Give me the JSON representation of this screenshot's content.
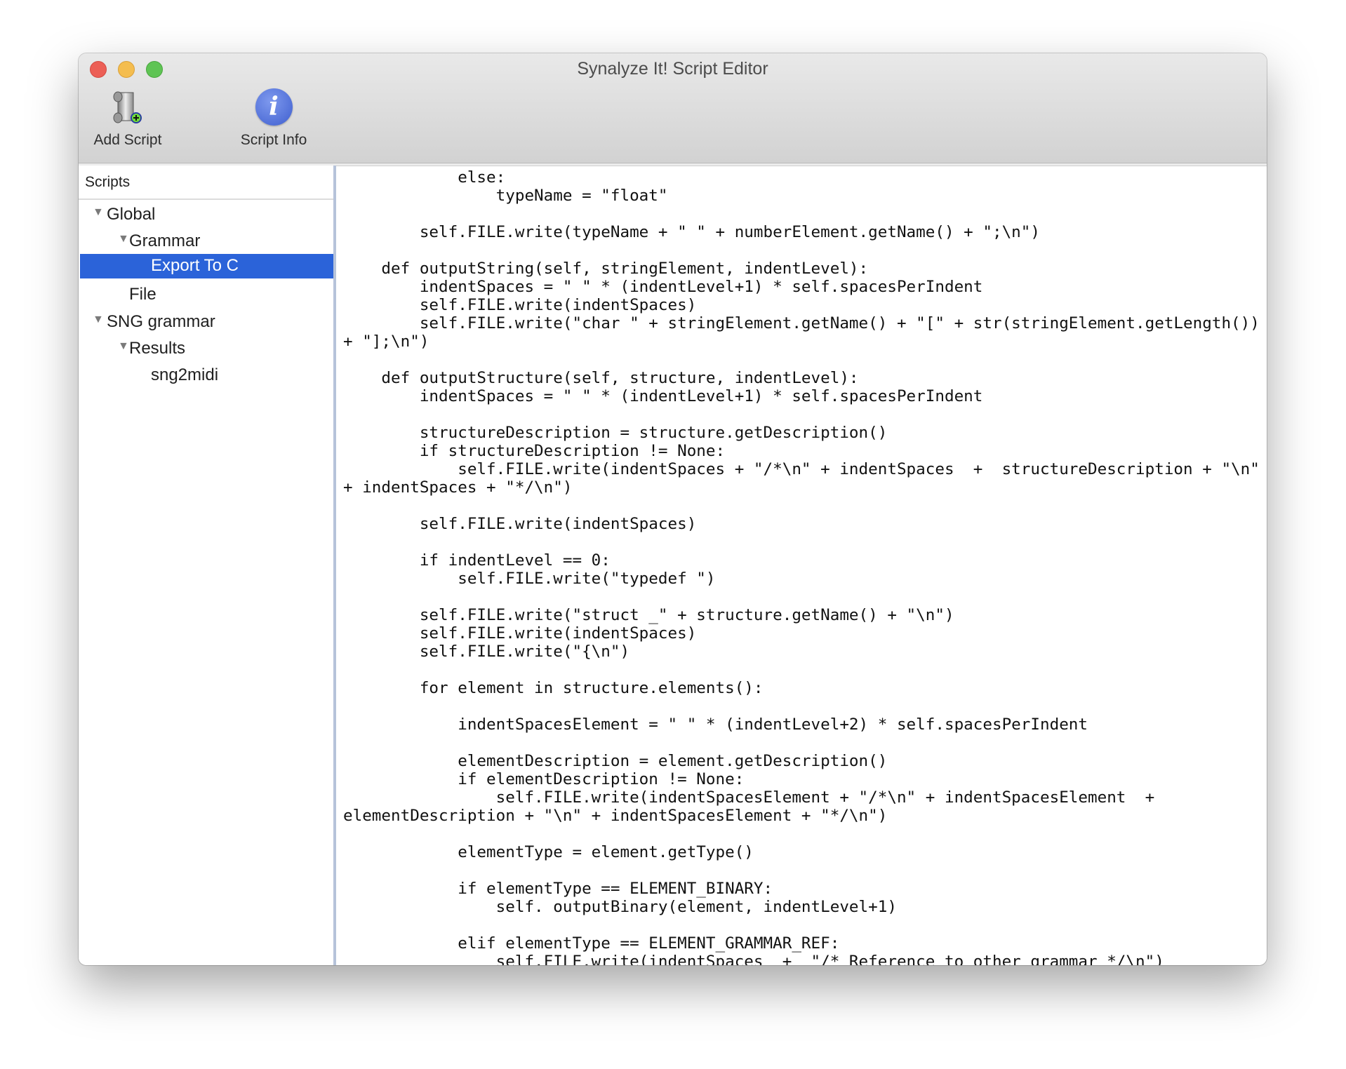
{
  "window": {
    "title": "Synalyze It! Script Editor",
    "traffic_lights": {
      "close": "#ec5f56",
      "minimize": "#f4bd4f",
      "zoom": "#5fc454"
    }
  },
  "toolbar": {
    "add_script": {
      "label": "Add Script",
      "icon": "scroll-add-icon"
    },
    "script_info": {
      "label": "Script Info",
      "icon": "info-icon"
    }
  },
  "sidebar": {
    "header": "Scripts",
    "selection_color": "#2b63d9",
    "items": [
      {
        "label": "Global",
        "level": 0,
        "expanded": true
      },
      {
        "label": "Grammar",
        "level": 1,
        "expanded": true
      },
      {
        "label": "Export To C",
        "level": 2,
        "selected": true
      },
      {
        "label": "File",
        "level": 1
      },
      {
        "label": "SNG grammar",
        "level": 0,
        "expanded": true
      },
      {
        "label": "Results",
        "level": 1,
        "expanded": true
      },
      {
        "label": "sng2midi",
        "level": 2
      }
    ]
  },
  "editor": {
    "lines": [
      "            else:",
      "                typeName = \"float\"",
      "",
      "        self.FILE.write(typeName + \" \" + numberElement.getName() + \";\\n\")",
      "",
      "    def outputString(self, stringElement, indentLevel):",
      "        indentSpaces = \" \" * (indentLevel+1) * self.spacesPerIndent",
      "        self.FILE.write(indentSpaces)",
      "        self.FILE.write(\"char \" + stringElement.getName() + \"[\" + str(stringElement.getLength())",
      "+ \"];\\n\")",
      "",
      "    def outputStructure(self, structure, indentLevel):",
      "        indentSpaces = \" \" * (indentLevel+1) * self.spacesPerIndent",
      "",
      "        structureDescription = structure.getDescription()",
      "        if structureDescription != None:",
      "            self.FILE.write(indentSpaces + \"/*\\n\" + indentSpaces  +  structureDescription + \"\\n\"",
      "+ indentSpaces + \"*/\\n\")",
      "",
      "        self.FILE.write(indentSpaces)",
      "",
      "        if indentLevel == 0:",
      "            self.FILE.write(\"typedef \")",
      "",
      "        self.FILE.write(\"struct _\" + structure.getName() + \"\\n\")",
      "        self.FILE.write(indentSpaces)",
      "        self.FILE.write(\"{\\n\")",
      "",
      "        for element in structure.elements():",
      "",
      "            indentSpacesElement = \" \" * (indentLevel+2) * self.spacesPerIndent",
      "",
      "            elementDescription = element.getDescription()",
      "            if elementDescription != None:",
      "                self.FILE.write(indentSpacesElement + \"/*\\n\" + indentSpacesElement  +",
      "elementDescription + \"\\n\" + indentSpacesElement + \"*/\\n\")",
      "",
      "            elementType = element.getType()",
      "",
      "            if elementType == ELEMENT_BINARY:",
      "                self. outputBinary(element, indentLevel+1)",
      "",
      "            elif elementType == ELEMENT_GRAMMAR_REF:",
      "                self.FILE.write(indentSpaces  +  \"/* Reference to other grammar */\\n\")"
    ]
  }
}
